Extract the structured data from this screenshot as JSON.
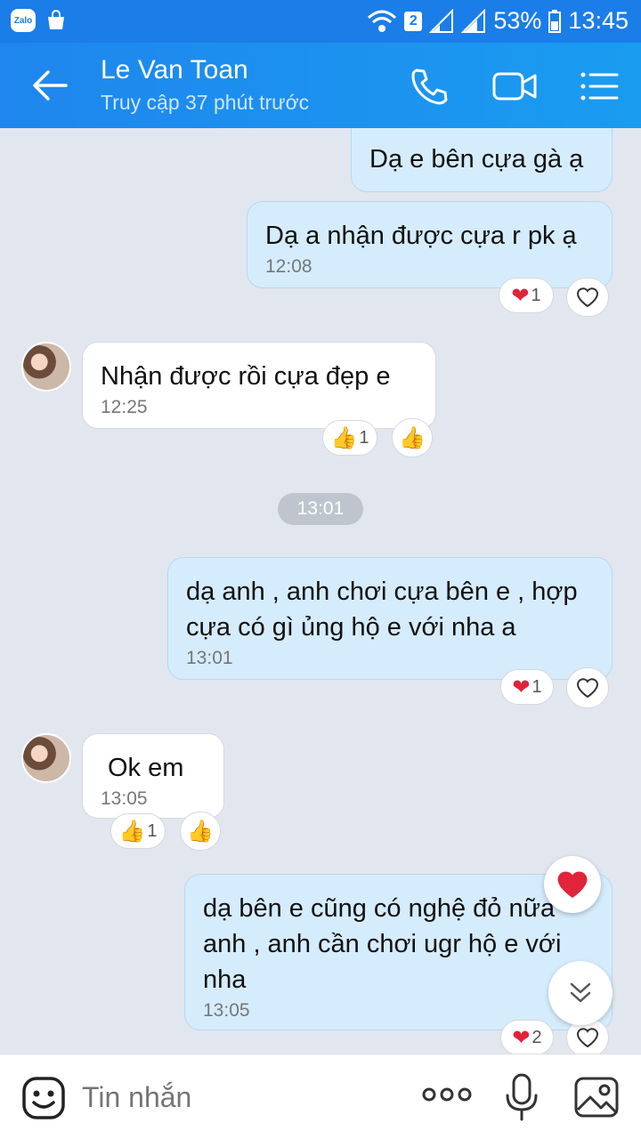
{
  "status_bar": {
    "app_badge": "Zalo",
    "sim": "2",
    "battery": "53%",
    "time": "13:45"
  },
  "header": {
    "title": "Le Van Toan",
    "subtitle": "Truy cập 37 phút trước"
  },
  "messages": [
    {
      "from": "me",
      "text": "Dạ e bên cựa gà ạ"
    },
    {
      "from": "me",
      "text": "Dạ a nhận được cựa r pk ạ",
      "time": "12:08",
      "reaction_count": "1"
    },
    {
      "from": "them",
      "text": "Nhận được rồi cựa đẹp e",
      "time": "12:25",
      "reaction_count": "1"
    },
    {
      "from": "me",
      "text_lines": [
        "dạ anh , anh chơi cựa bên e , hợp",
        "cựa có gì ủng hộ e với nha a"
      ],
      "time": "13:01",
      "reaction_count": "1"
    },
    {
      "from": "them",
      "text": "Ok em",
      "time": "13:05",
      "reaction_count": "1"
    },
    {
      "from": "me",
      "text_lines": [
        "dạ bên e cũng có nghệ đỏ nữa",
        "anh  , anh cần chơi ugr hộ e với",
        "nha"
      ],
      "time": "13:05",
      "reaction_count": "2"
    }
  ],
  "time_divider": "13:01",
  "input": {
    "placeholder": "Tin nhắn"
  },
  "colors": {
    "header": "#1e86ee",
    "my_bubble": "#d5ecfd",
    "their_bubble": "#ffffff",
    "background": "#e2e6ef",
    "heart": "#e0243a"
  },
  "icons": [
    "back-arrow-icon",
    "phone-icon",
    "video-call-icon",
    "menu-list-icon",
    "heart-icon",
    "thumbs-up-icon",
    "emoji-icon",
    "more-dots-icon",
    "microphone-icon",
    "image-icon",
    "chevron-double-down-icon"
  ]
}
